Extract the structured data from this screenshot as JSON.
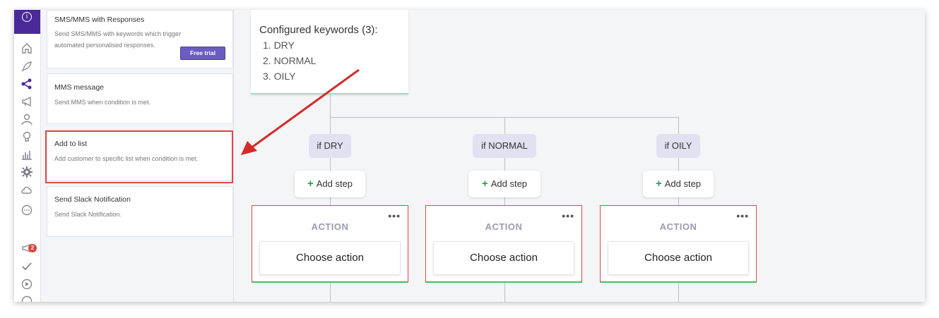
{
  "rail": {
    "icons": [
      "info-icon",
      "home-icon",
      "rocket-icon",
      "share-icon",
      "megaphone-icon",
      "user-icon",
      "lightbulb-icon",
      "bar-chart-icon",
      "gear-icon",
      "cloud-icon",
      "chat-icon",
      "notification-icon",
      "check-icon",
      "play-icon",
      "circle-icon"
    ],
    "notification_count": "2",
    "accent": "#4a2a9a"
  },
  "panel": {
    "cards": [
      {
        "title": "SMS/MMS with Responses",
        "desc": "Send SMS/MMS with keywords which trigger automated personalised responses.",
        "button": "Free trial"
      },
      {
        "title": "MMS message",
        "desc": "Send MMS when condition is met."
      },
      {
        "title": "Add to list",
        "desc": "Add customer to specific list when condition is met."
      },
      {
        "title": "Send Slack Notification",
        "desc": "Send Slack Notification."
      }
    ]
  },
  "canvas": {
    "keywords_header": "Configured keywords (3):",
    "keywords": [
      "1. DRY",
      "2. NORMAL",
      "3. OILY"
    ],
    "branches": [
      {
        "condition": "if DRY",
        "add_step": "Add step",
        "action_label": "ACTION",
        "choose": "Choose action"
      },
      {
        "condition": "if NORMAL",
        "add_step": "Add step",
        "action_label": "ACTION",
        "choose": "Choose action"
      },
      {
        "condition": "if OILY",
        "add_step": "Add step",
        "action_label": "ACTION",
        "choose": "Choose action"
      }
    ],
    "more_icon": "•••"
  },
  "colors": {
    "highlight": "#e04848",
    "arrow": "#d42a2a",
    "trial_button": "#6b5cc2"
  }
}
